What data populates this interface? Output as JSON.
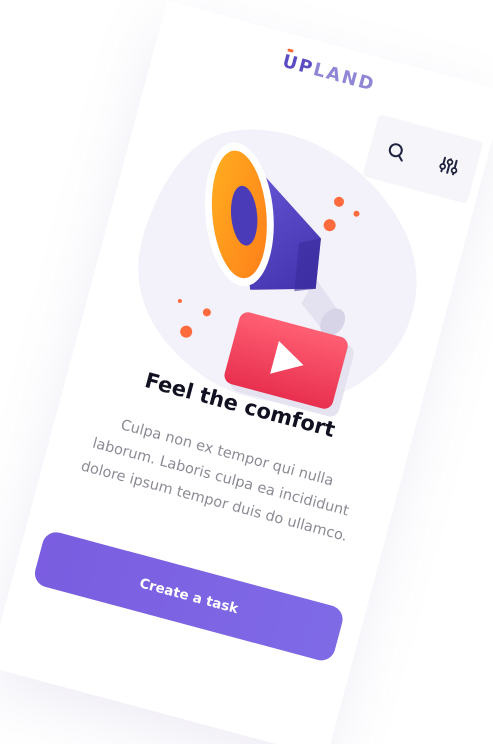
{
  "brand": {
    "logo_up": "UP",
    "logo_rest": "LAND"
  },
  "toolbar": {
    "search_icon": "search-icon",
    "filter_icon": "sliders-icon"
  },
  "illustration": {
    "icon": "megaphone-icon",
    "badge_icon": "play-icon"
  },
  "content": {
    "title": "Feel the comfort",
    "description": "Culpa non ex tempor qui nulla laborum. Laboris culpa ea incididunt dolore ipsum tempor duis do ullamco."
  },
  "cta": {
    "label": "Create a task"
  },
  "colors": {
    "accent": "#7a5de0",
    "brand": "#5b4cc4",
    "orange": "#ff6b3d",
    "red": "#f0435e"
  }
}
